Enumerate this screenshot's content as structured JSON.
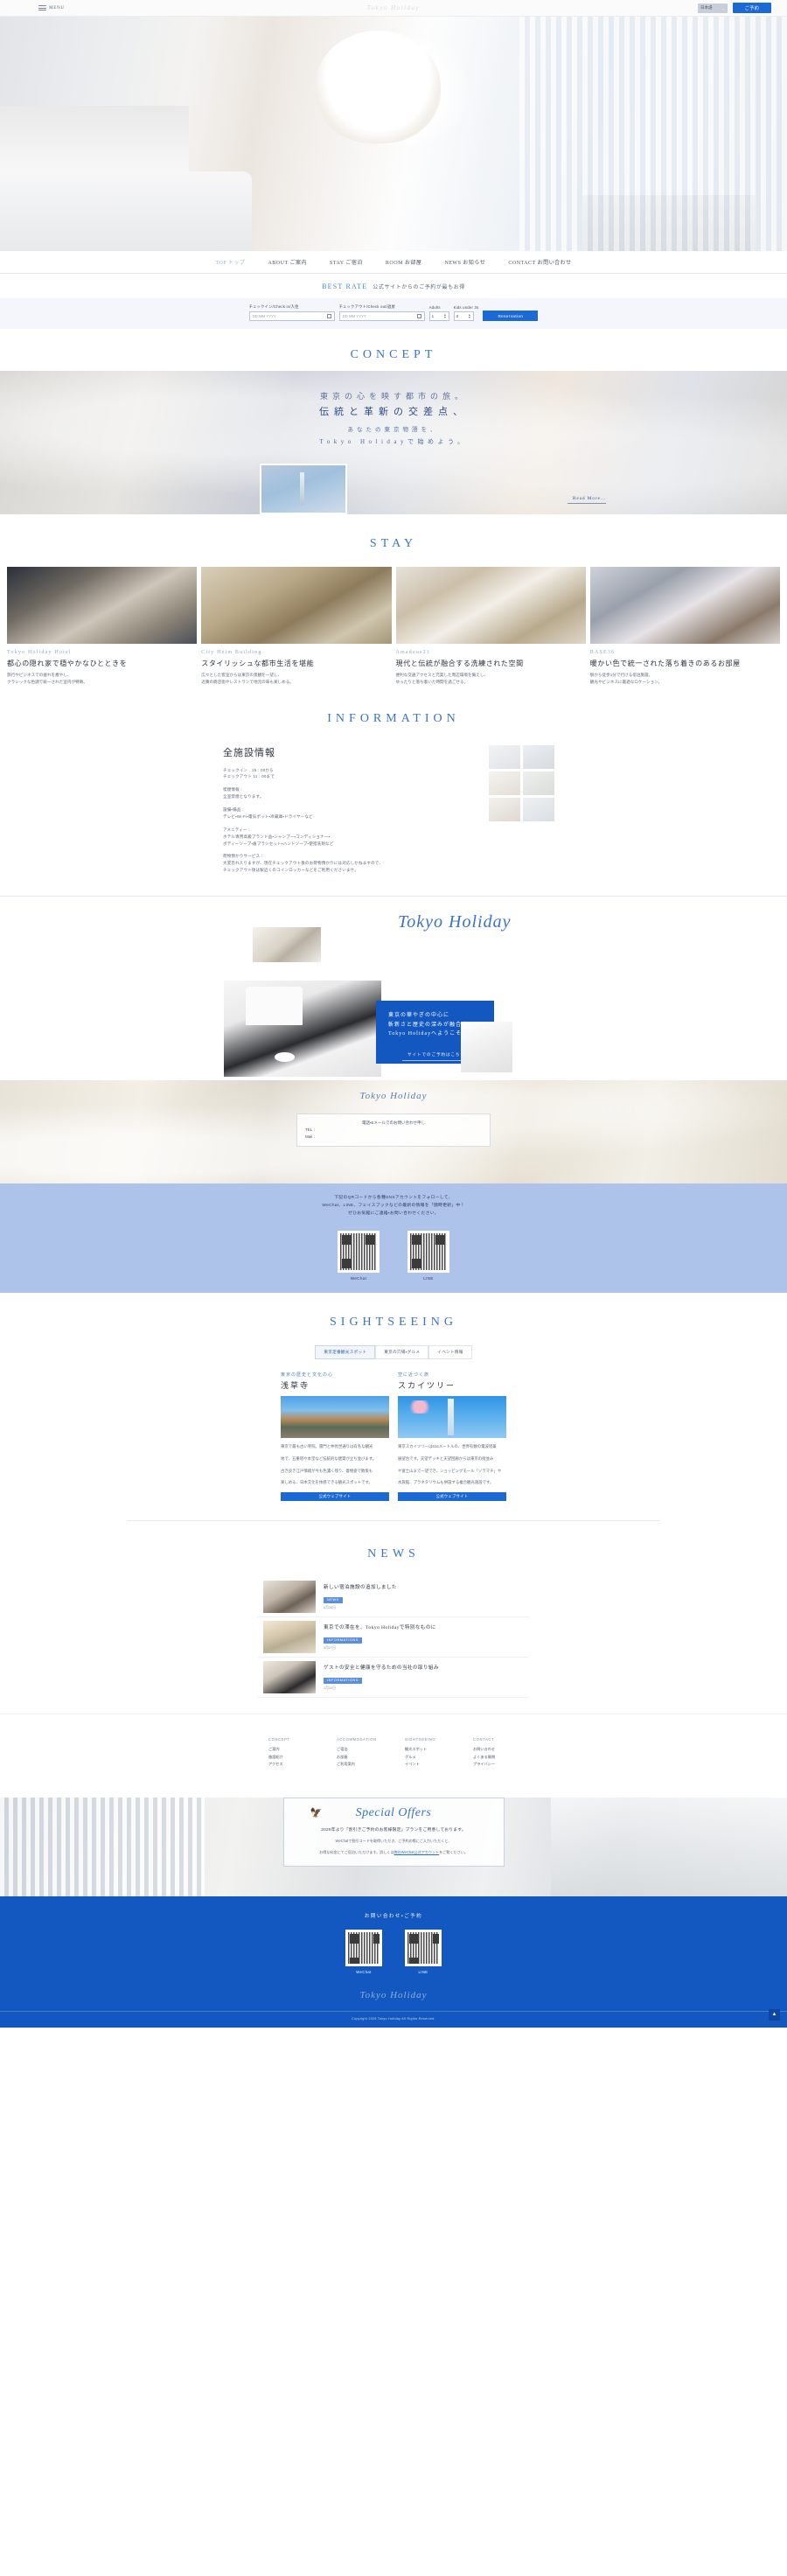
{
  "header": {
    "menu_label": "MENU",
    "brand": "Tokyo Holiday",
    "language": "日本語",
    "caret": "⌄",
    "reserve_label": "ご予約"
  },
  "nav": {
    "items": [
      {
        "en": "TOP",
        "jp": "トップ",
        "active": true
      },
      {
        "en": "ABOUT",
        "jp": "ご案内",
        "active": false
      },
      {
        "en": "STAY",
        "jp": "ご宿泊",
        "active": false
      },
      {
        "en": "ROOM",
        "jp": "お部屋",
        "active": false
      },
      {
        "en": "NEWS",
        "jp": "お知らせ",
        "active": false
      },
      {
        "en": "CONTACT",
        "jp": "お問い合わせ",
        "active": false
      }
    ]
  },
  "bestrate": {
    "en": "BEST RATE",
    "jp": "公式サイトからのご予約が最もお得",
    "checkin_label": "チェックイン/Check in/入住",
    "checkout_label": "チェックアウト/Check out/退房",
    "adults_label": "Adults",
    "kids_label": "Kids under 3s",
    "date_placeholder": "DD MM YYYY",
    "adults_value": "1",
    "kids_value": "0",
    "submit_label": "Reservation",
    "spin_up": "▲",
    "spin_down": "▼"
  },
  "concept": {
    "title": "CONCEPT",
    "line1": "東京の心を映す都市の旅。",
    "line2": "伝統と革新の交差点、",
    "line3": "あなたの東京物語を、",
    "line4": "Tokyo Holidayで始めよう。",
    "readmore": "Read More…"
  },
  "stay": {
    "title": "STAY",
    "cards": [
      {
        "en": "Tokyo Holiday Hotel",
        "jp": "都心の隠れ家で穏やかなひとときを",
        "desc1": "旅行やビジネスでの疲れを癒やし、",
        "desc2": "クラシックな色調で統一された室内が特徴。"
      },
      {
        "en": "City Heim Building",
        "jp": "スタイリッシュな都市生活を堪能",
        "desc1": "広々とした客室からは東京の景観を一望し、",
        "desc2": "近隣の商店街やレストランで地元の味も楽しめる。"
      },
      {
        "en": "Amadeus21",
        "jp": "現代と伝統が融合する洗練された空間",
        "desc1": "便利な交通アクセスと充実した周辺環境を備えし、",
        "desc2": "ゆったりと落ち着いた時間を過ごせる。"
      },
      {
        "en": "BASE36",
        "jp": "暖かい色で統一された落ち着きのあるお部屋",
        "desc1": "駅から徒歩1分で行ける宿泊施設。",
        "desc2": "観光やビジネスに最適なロケーション。"
      }
    ]
  },
  "information": {
    "title": "INFORMATION",
    "heading": "全施設情報",
    "blocks": [
      {
        "lines": [
          "チェックイン　15：00から",
          "チェックアウト 11：00まで"
        ]
      },
      {
        "lines": [
          "喫煙情報：",
          "全室禁煙となります。"
        ]
      },
      {
        "lines": [
          "設備・備品：",
          "テレビ・Wi-Fi・電気ポット・冷蔵庫・ドライヤーなど"
        ]
      },
      {
        "lines": [
          "アメニティー：",
          "ホテル専用高級ブランド品・シャンプー・コンディショナー・",
          "ボディーソープ・歯ブラシセット・ハンドソープ・使捨洗剤など"
        ]
      },
      {
        "lines": [
          "荷物預かりサービス：",
          "大変恐れ入りますが、現在チェックアウト後のお荷物預かりには対応しかねますので、",
          "チェックアウト後は駅近くのコインロッカーなどをご利用くださいませ。"
        ]
      }
    ]
  },
  "promo": {
    "script_title": "Tokyo Holiday",
    "card_line1": "東京の華やぎの中心に",
    "card_line2": "斬新さと歴史の深みが融合する",
    "card_line3": "Tokyo Holidayへようこそ",
    "card_cta": "サイトでのご予約はこちら"
  },
  "contact_band": {
    "script_title": "Tokyo Holiday",
    "line1": "電話・Eメールでのお問い合わせ申し",
    "line2": "TEL：",
    "line3": "Mail：",
    "sns_lead1": "下記のQRコードから各種SNSアカウントをフォローして、",
    "sns_lead2": "WeChat、LINE、フェイスブックなどの最新の情報を「随時更新」中！",
    "sns_lead3": "ぜひお気軽にご連絡・お問い合わせください。",
    "qr": [
      {
        "caption": "WeChat"
      },
      {
        "caption": "LINE"
      }
    ]
  },
  "sightseeing": {
    "title": "SIGHTSEEING",
    "tabs": [
      {
        "label": "東京定番観光スポット",
        "active": true
      },
      {
        "label": "東京の穴場・グルメ",
        "active": false
      },
      {
        "label": "イベント情報",
        "active": false
      }
    ],
    "cards": [
      {
        "sub": "東京の歴史と文化の心",
        "name": "浅草寺",
        "desc1": "東京で最も古い寺院。雷門と仲見世通りは有名な観光",
        "desc2": "地で、五重塔や本堂など伝統的な建築が立ち並びます。",
        "desc3": "古き良き江戸情緒が今も色濃く残り、着物姿で散策も",
        "desc4": "楽しめる、日本文化を体感できる観光スポットです。",
        "button": "公式ウェブサイト"
      },
      {
        "sub": "空に近づく旅",
        "name": "スカイツリー",
        "desc1": "東京スカイツリーは634メートルの、世界有数の電波塔兼",
        "desc2": "展望台です。天望デッキと天望回廊からは東京の街並み",
        "desc3": "や富士山まで一望でき、ショッピングモール「ソラマチ」や",
        "desc4": "水族館、プラネタリウムも併設する複合観光施設です。",
        "button": "公式ウェブサイト"
      }
    ]
  },
  "news": {
    "title": "NEWS",
    "items": [
      {
        "title": "新しい宿泊施設の追加しました",
        "badge": "NEWS",
        "date": "6月26日"
      },
      {
        "title": "東京での滞在を、Tokyo Holidayで特別なものに",
        "badge": "INFORMATIONS",
        "date": "3月27日"
      },
      {
        "title": "ゲストの安全と健康を守るための当社の取り組み",
        "badge": "INFORMATIONS",
        "date": "1月10日"
      }
    ]
  },
  "footer_links": {
    "columns": [
      {
        "heading": "CONCEPT",
        "items": [
          "ご案内",
          "施設紹介",
          "アクセス"
        ]
      },
      {
        "heading": "ACCOMMODATION",
        "items": [
          "ご宿泊",
          "お部屋",
          "ご利用案内"
        ]
      },
      {
        "heading": "SIGHTSEEING",
        "items": [
          "観光スポット",
          "グルメ",
          "イベント"
        ]
      },
      {
        "heading": "CONTACT",
        "items": [
          "お問い合わせ",
          "よくある質問",
          "プライバシー"
        ]
      }
    ]
  },
  "offers": {
    "bird_icon": "bird-icon",
    "title": "Special Offers",
    "lead": "2025年より「割引きご予約のお客様限定」プランをご用意しております。",
    "sub1": "WeChatで割引コードを取得いただき、ご予約の際にご入力いただくと、",
    "sub2": "お得な料金にてご宿泊いただけます。詳しくは",
    "sub_link": "弊社WeChat公式アカウント",
    "sub3": "をご覧ください。"
  },
  "blue_footer": {
    "title": "お問い合わせ・ご予約",
    "qr": [
      {
        "caption": "WeChat"
      },
      {
        "caption": "LINE"
      }
    ],
    "logo": "Tokyo Holiday",
    "copyright": "Copyright 2025 Tokyo Holiday All Rights Reserved.",
    "to_top": "▲"
  },
  "colors": {
    "accent_blue": "#1357c0",
    "link_blue": "#3b73c4",
    "badge_blue": "#5b8fd9",
    "band_blue": "#aec3ea"
  }
}
